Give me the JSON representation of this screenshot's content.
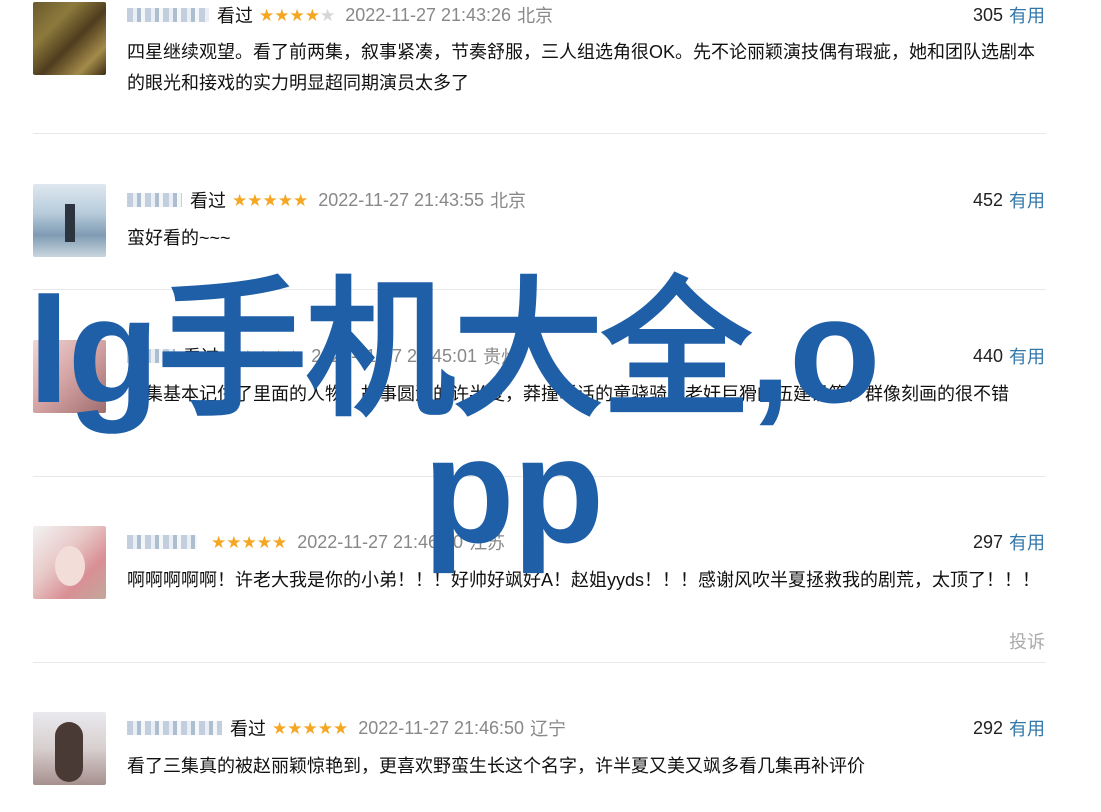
{
  "watermark": {
    "line1": "lg手机大全,o",
    "line2": "pp"
  },
  "comments": [
    {
      "verb": "看过",
      "stars": 4,
      "date": "2022-11-27 21:43:26",
      "location": "北京",
      "votes": "305",
      "useful": "有用",
      "text": "四星继续观望。看了前两集，叙事紧凑，节奏舒服，三人组选角很OK。先不论丽颖演技偶有瑕疵，她和团队选剧本的眼光和接戏的实力明显超同期演员太多了"
    },
    {
      "verb": "看过",
      "stars": 5,
      "date": "2022-11-27 21:43:55",
      "location": "北京",
      "votes": "452",
      "useful": "有用",
      "text": "蛮好看的~~~"
    },
    {
      "verb": "看过",
      "stars": 5,
      "date": "2022-11-27 21:45:01",
      "location": "贵州",
      "votes": "440",
      "useful": "有用",
      "text": "两集基本记住了里面的人物，故事圆润的许半夏，莽撞听话的童骁骑，老奸巨猾的伍建设等，群像刻画的很不错"
    },
    {
      "verb": "",
      "stars": 5,
      "date": "2022-11-27 21:46:10",
      "location": "江苏",
      "votes": "297",
      "useful": "有用",
      "text": "啊啊啊啊啊！许老大我是你的小弟！！！好帅好飒好A！赵姐yyds！！！感谢风吹半夏拯救我的剧荒，太顶了！！！",
      "report": "投诉"
    },
    {
      "verb": "看过",
      "stars": 5,
      "date": "2022-11-27 21:46:50",
      "location": "辽宁",
      "votes": "292",
      "useful": "有用",
      "text": "看了三集真的被赵丽颖惊艳到，更喜欢野蛮生长这个名字，许半夏又美又飒多看几集再补评价"
    }
  ],
  "colors": {
    "star": "#f5a623",
    "useful_link": "#3377aa",
    "watermark": "#1e5fa8"
  }
}
